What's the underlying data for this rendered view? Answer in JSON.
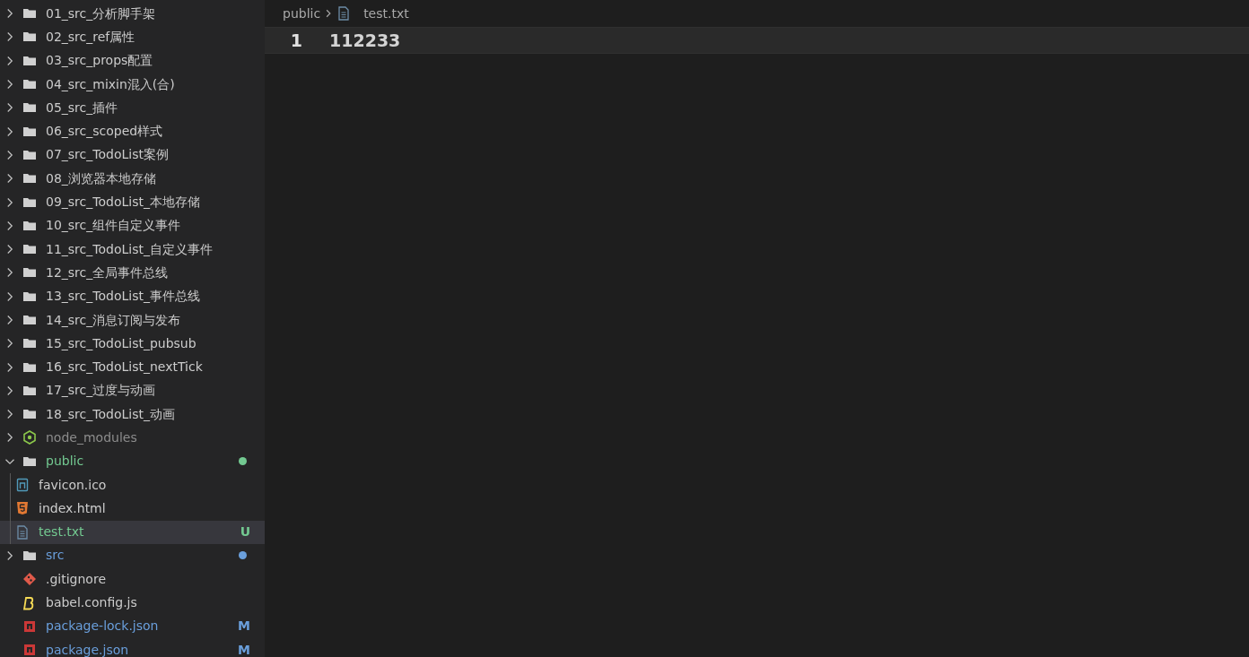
{
  "explorer": {
    "items": [
      {
        "name": "01_src_分析脚手架",
        "kind": "folder",
        "expanded": false
      },
      {
        "name": "02_src_ref属性",
        "kind": "folder",
        "expanded": false
      },
      {
        "name": "03_src_props配置",
        "kind": "folder",
        "expanded": false
      },
      {
        "name": "04_src_mixin混入(合)",
        "kind": "folder",
        "expanded": false
      },
      {
        "name": "05_src_插件",
        "kind": "folder",
        "expanded": false
      },
      {
        "name": "06_src_scoped样式",
        "kind": "folder",
        "expanded": false
      },
      {
        "name": "07_src_TodoList案例",
        "kind": "folder",
        "expanded": false
      },
      {
        "name": "08_浏览器本地存储",
        "kind": "folder",
        "expanded": false
      },
      {
        "name": "09_src_TodoList_本地存储",
        "kind": "folder",
        "expanded": false
      },
      {
        "name": "10_src_组件自定义事件",
        "kind": "folder",
        "expanded": false
      },
      {
        "name": "11_src_TodoList_自定义事件",
        "kind": "folder",
        "expanded": false
      },
      {
        "name": "12_src_全局事件总线",
        "kind": "folder",
        "expanded": false
      },
      {
        "name": "13_src_TodoList_事件总线",
        "kind": "folder",
        "expanded": false
      },
      {
        "name": "14_src_消息订阅与发布",
        "kind": "folder",
        "expanded": false
      },
      {
        "name": "15_src_TodoList_pubsub",
        "kind": "folder",
        "expanded": false
      },
      {
        "name": "16_src_TodoList_nextTick",
        "kind": "folder",
        "expanded": false
      },
      {
        "name": "17_src_过度与动画",
        "kind": "folder",
        "expanded": false
      },
      {
        "name": "18_src_TodoList_动画",
        "kind": "folder",
        "expanded": false
      },
      {
        "name": "node_modules",
        "kind": "modules",
        "expanded": false,
        "color": "#8c8c8c"
      },
      {
        "name": "public",
        "kind": "folder",
        "expanded": true,
        "color": "#73c991",
        "dot": true,
        "children": [
          {
            "name": "favicon.ico",
            "kind": "favicon",
            "selected": false
          },
          {
            "name": "index.html",
            "kind": "html",
            "selected": false
          },
          {
            "name": "test.txt",
            "kind": "text",
            "selected": true,
            "color": "#73c991",
            "badge": "U"
          }
        ]
      },
      {
        "name": "src",
        "kind": "folder",
        "expanded": false,
        "color": "#6a9fdc",
        "dot": true
      },
      {
        "name": ".gitignore",
        "kind": "gitignore",
        "selected": false
      },
      {
        "name": "babel.config.js",
        "kind": "babel",
        "selected": false
      },
      {
        "name": "package-lock.json",
        "kind": "npm",
        "selected": false,
        "color": "#6a9fdc",
        "badge": "M"
      },
      {
        "name": "package.json",
        "kind": "npm",
        "selected": false,
        "color": "#6a9fdc",
        "badge": "M"
      }
    ]
  },
  "editor": {
    "breadcrumbs": [
      {
        "label": "public",
        "kind": "folder"
      },
      {
        "label": "test.txt",
        "kind": "file"
      }
    ],
    "lines": [
      {
        "number": "1",
        "text": "112233",
        "current": true
      }
    ]
  }
}
